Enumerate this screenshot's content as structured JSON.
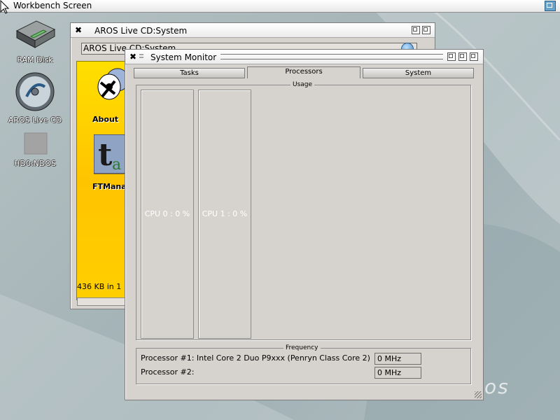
{
  "screen": {
    "title": "Workbench Screen"
  },
  "desktop": {
    "icons": [
      {
        "label": "RAM Disk"
      },
      {
        "label": "AROS Live CD"
      },
      {
        "label": "HD0:NDOS"
      }
    ]
  },
  "aros_window": {
    "title": "AROS Live CD:System",
    "path": "AROS Live CD:System",
    "icons": [
      {
        "label": "About"
      },
      {
        "label": "FTManag"
      }
    ],
    "status": "436 KB in 1"
  },
  "sysmon": {
    "title": "System Monitor",
    "tabs": [
      {
        "label": "Tasks",
        "active": false
      },
      {
        "label": "Processors",
        "active": true
      },
      {
        "label": "System",
        "active": false
      }
    ],
    "usage": {
      "legend": "Usage",
      "cpus": [
        {
          "label": "CPU 0 : 0 %",
          "percent": 0
        },
        {
          "label": "CPU 1 : 0 %",
          "percent": 0
        }
      ]
    },
    "frequency": {
      "legend": "Frequency",
      "rows": [
        {
          "label": "Processor #1: Intel Core 2 Duo P9xxx (Penryn Class Core 2)",
          "value": "0 MHz"
        },
        {
          "label": "Processor #2:",
          "value": "0 MHz"
        }
      ]
    }
  },
  "wallpaper": {
    "logo_text": "os"
  },
  "colors": {
    "accent": "#6aa4cc",
    "folder_bg": "#ffcc00",
    "panel": "#d6d3ce"
  }
}
